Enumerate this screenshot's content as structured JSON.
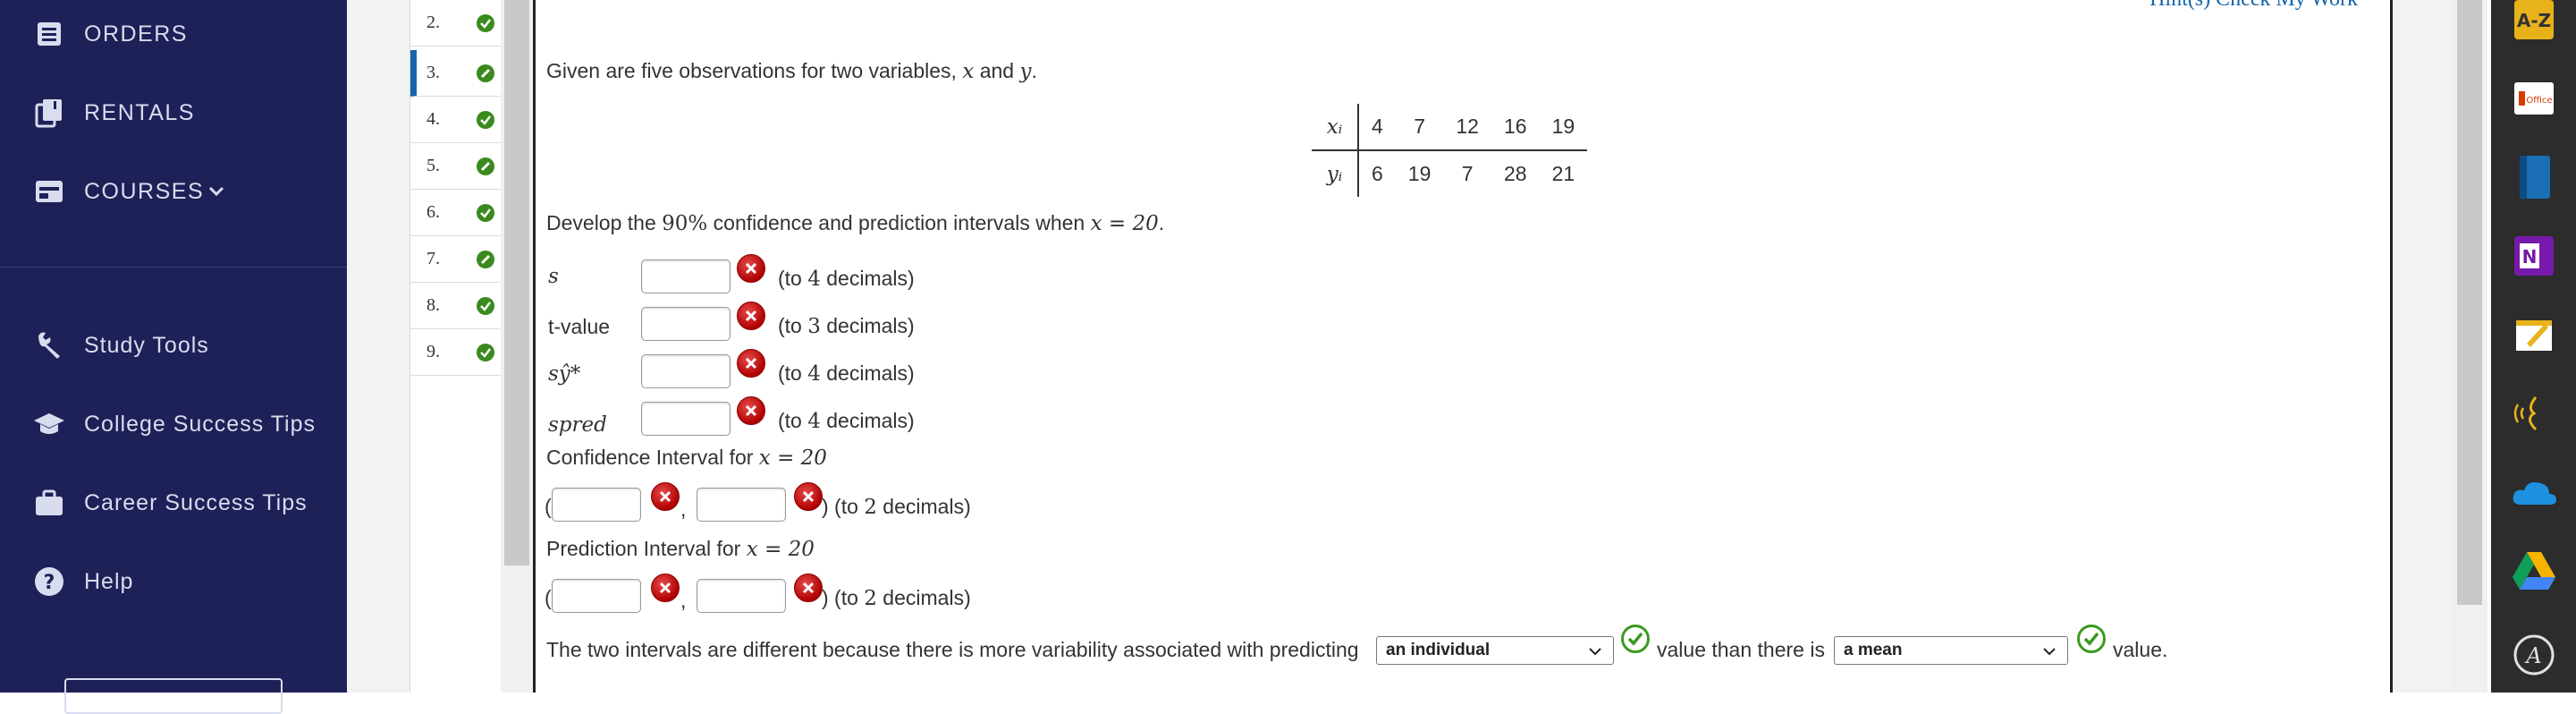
{
  "sidebar": {
    "items": [
      {
        "label": "ORDERS",
        "icon": "list-icon"
      },
      {
        "label": "RENTALS",
        "icon": "books-icon"
      },
      {
        "label": "COURSES",
        "icon": "courses-icon"
      },
      {
        "label": "Study Tools",
        "icon": "wrench-icon"
      },
      {
        "label": "College Success Tips",
        "icon": "graduation-cap-icon"
      },
      {
        "label": "Career Success Tips",
        "icon": "briefcase-icon"
      },
      {
        "label": "Help",
        "icon": "help-icon"
      }
    ]
  },
  "questions": [
    {
      "num": "2.",
      "status": "complete"
    },
    {
      "num": "3.",
      "status": "partial",
      "active": true
    },
    {
      "num": "4.",
      "status": "complete"
    },
    {
      "num": "5.",
      "status": "partial"
    },
    {
      "num": "6.",
      "status": "complete"
    },
    {
      "num": "7.",
      "status": "partial"
    },
    {
      "num": "8.",
      "status": "complete"
    },
    {
      "num": "9.",
      "status": "complete"
    }
  ],
  "header_links": "Hint(s)   Check My Work",
  "problem": {
    "intro_a": "Given are five observations for two variables, ",
    "var_x": "x",
    "intro_and": " and ",
    "var_y": "y",
    "intro_end": ".",
    "table": {
      "x_label": "xᵢ",
      "y_label": "yᵢ",
      "x_values": [
        "4",
        "7",
        "12",
        "16",
        "19"
      ],
      "y_values": [
        "6",
        "19",
        "7",
        "28",
        "21"
      ]
    },
    "develop_a": "Develop the ",
    "develop_pct": "90%",
    "develop_b": " confidence and prediction intervals when ",
    "develop_eq": "x = 20",
    "develop_end": ".",
    "rows": [
      {
        "label": "s",
        "hint_a": "(to ",
        "hint_n": "4",
        "hint_b": " decimals)"
      },
      {
        "label": "t-value",
        "hint_a": "(to ",
        "hint_n": "3",
        "hint_b": " decimals)"
      },
      {
        "label": "sŷ*",
        "hint_a": "(to ",
        "hint_n": "4",
        "hint_b": " decimals)"
      },
      {
        "label": "spred",
        "hint_a": "(to ",
        "hint_n": "4",
        "hint_b": " decimals)"
      }
    ],
    "ci_label": "Confidence Interval for ",
    "ci_eq": "x = 20",
    "pi_label": "Prediction Interval for ",
    "pi_eq": "x = 20",
    "interval_hint_a": ") (to ",
    "interval_hint_n": "2",
    "interval_hint_b": " decimals)",
    "open_paren": "(",
    "comma": ",",
    "final_a": "The two intervals are different because there is more variability associated with predicting",
    "select1": "an individual",
    "final_b": "value than there is",
    "select2": "a mean",
    "final_c": "value."
  },
  "tools": [
    "a-z-icon",
    "office-icon",
    "book-icon",
    "onenote-icon",
    "notepad-icon",
    "read-aloud-icon",
    "onedrive-icon",
    "google-drive-icon",
    "accessibility-icon"
  ],
  "tool_labels": {
    "az": "A-Z",
    "office": "Office"
  }
}
